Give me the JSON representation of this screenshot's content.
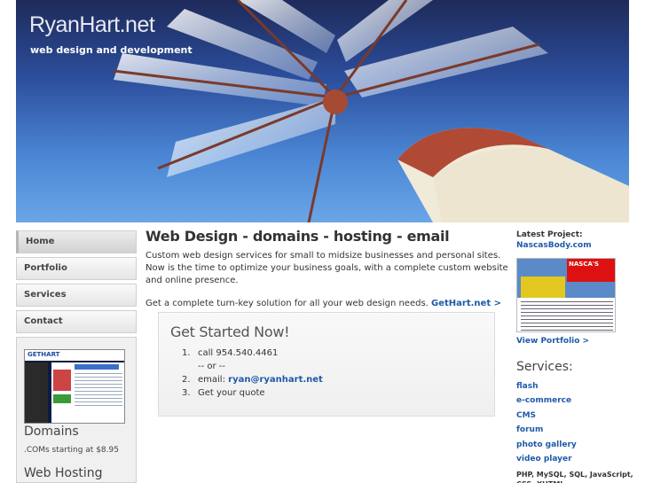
{
  "header": {
    "title": "RyanHart.net",
    "tagline": "web design and development"
  },
  "nav": {
    "items": [
      {
        "label": "Home"
      },
      {
        "label": "Portfolio"
      },
      {
        "label": "Services"
      },
      {
        "label": "Contact"
      }
    ]
  },
  "promo": {
    "screenshot_logo": "GETHART",
    "domains_heading": "Domains",
    "domains_sub": ".COMs starting at $8.95",
    "hosting_heading": "Web Hosting"
  },
  "main": {
    "title": "Web Design - domains - hosting - email",
    "intro": "Custom web design services for small to midsize businesses and personal sites. Now is the time to optimize your business goals, with a complete custom website and online presence.",
    "cta_text": "Get a complete turn-key solution for all your web design needs.",
    "cta_link": "GetHart.net >"
  },
  "get_started": {
    "title": "Get Started Now!",
    "step1_num": "1.",
    "step1": "call 954.540.4461",
    "or": "-- or --",
    "step2_num": "2.",
    "step2_label": "email:",
    "step2_email": "ryan@ryanhart.net",
    "step3_num": "3.",
    "step3": "Get your quote"
  },
  "right": {
    "latest_label": "Latest Project:",
    "latest_link": "NascasBody.com",
    "thumb_banner": "NASCA'S",
    "view_portfolio": "View Portfolio >",
    "services_heading": "Services:",
    "services": [
      "flash",
      "e-commerce",
      "CMS",
      "forum",
      "photo gallery",
      "video player"
    ],
    "tech": "PHP, MySQL, SQL, JavaScript, CSS, XHTML"
  },
  "colors": {
    "link": "#1f5aa8",
    "sky_top": "#1e2a5a",
    "sky_bottom": "#6aa6e6"
  }
}
